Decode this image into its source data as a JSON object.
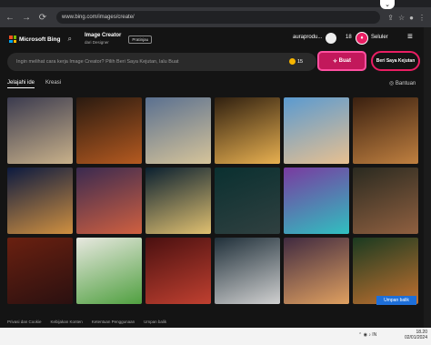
{
  "browser": {
    "url": "www.bing.com/images/create/"
  },
  "header": {
    "brand": "Microsoft Bing",
    "product": "Image Creator",
    "product_sub": "dari Designer",
    "preview": "Pratinjau",
    "user": "auraprodu...",
    "coins": "18",
    "mobile": "Seluler"
  },
  "prompt": {
    "placeholder": "Ingin melihat cara kerja Image Creator? Pilih Beri Saya Kejutan, lalu Buat",
    "count": "15",
    "create": "Buat",
    "surprise": "Beri Saya Kejutan"
  },
  "tabs": [
    {
      "label": "Jelajahi ide"
    },
    {
      "label": "Kreasi"
    }
  ],
  "help": "Bantuan",
  "footer": [
    "Privasi dan Cookie",
    "Kebijakan Konten",
    "Ketentuan Penggunaan",
    "Umpan balik"
  ],
  "feedback": "Umpan balik",
  "tiles": [
    {
      "c1": "#3b3b4f",
      "c2": "#c9b18a"
    },
    {
      "c1": "#2a1a10",
      "c2": "#b55a20"
    },
    {
      "c1": "#5a7090",
      "c2": "#d6c49a"
    },
    {
      "c1": "#302010",
      "c2": "#e8b050"
    },
    {
      "c1": "#5a9ad0",
      "c2": "#e8c090"
    },
    {
      "c1": "#3a2010",
      "c2": "#c08040"
    },
    {
      "c1": "#0c1a40",
      "c2": "#d09040"
    },
    {
      "c1": "#3a2a50",
      "c2": "#d06040"
    },
    {
      "c1": "#0a2030",
      "c2": "#e0c070"
    },
    {
      "c1": "#0a3030",
      "c2": "#304040"
    },
    {
      "c1": "#7a3aa0",
      "c2": "#30c0c0"
    },
    {
      "c1": "#2a2a20",
      "c2": "#906040"
    },
    {
      "c1": "#6a2010",
      "c2": "#2a1010"
    },
    {
      "c1": "#e8e8e0",
      "c2": "#50a040"
    },
    {
      "c1": "#4a1010",
      "c2": "#c04030"
    },
    {
      "c1": "#20303a",
      "c2": "#d0d0d0"
    },
    {
      "c1": "#402a40",
      "c2": "#e0a060"
    },
    {
      "c1": "#1a3a20",
      "c2": "#c07030"
    }
  ],
  "taskbar": {
    "time": "18.20",
    "date": "02/01/2024",
    "lang": "IN"
  }
}
